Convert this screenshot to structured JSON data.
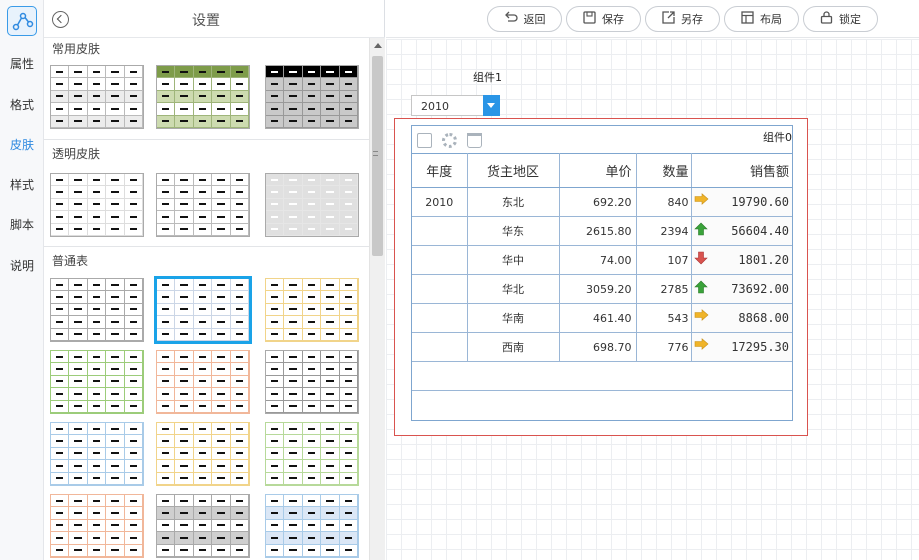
{
  "rail": {
    "tabs": [
      {
        "label": "属性",
        "active": false
      },
      {
        "label": "格式",
        "active": false
      },
      {
        "label": "皮肤",
        "active": true
      },
      {
        "label": "样式",
        "active": false
      },
      {
        "label": "脚本",
        "active": false
      },
      {
        "label": "说明",
        "active": false
      }
    ]
  },
  "panel": {
    "title": "设置",
    "sections": {
      "common": "常用皮肤",
      "transparent": "透明皮肤",
      "normal": "普通表"
    }
  },
  "toolbar": {
    "back": "返回",
    "save": "保存",
    "save_as": "另存",
    "layout": "布局",
    "lock": "锁定"
  },
  "canvas": {
    "widget1_label": "组件1",
    "select_value": "2010",
    "widget0_label": "组件0",
    "table": {
      "headers": [
        "年度",
        "货主地区",
        "单价",
        "数量",
        "销售额"
      ],
      "rows": [
        {
          "year": "2010",
          "region": "东北",
          "price": "692.20",
          "qty": "840",
          "trend": "right",
          "sales": "19790.60"
        },
        {
          "year": "",
          "region": "华东",
          "price": "2615.80",
          "qty": "2394",
          "trend": "up",
          "sales": "56604.40"
        },
        {
          "year": "",
          "region": "华中",
          "price": "74.00",
          "qty": "107",
          "trend": "down",
          "sales": "1801.20"
        },
        {
          "year": "",
          "region": "华北",
          "price": "3059.20",
          "qty": "2785",
          "trend": "up",
          "sales": "73692.00"
        },
        {
          "year": "",
          "region": "华南",
          "price": "461.40",
          "qty": "543",
          "trend": "right",
          "sales": "8868.00"
        },
        {
          "year": "",
          "region": "西南",
          "price": "698.70",
          "qty": "776",
          "trend": "right",
          "sales": "17295.30"
        }
      ]
    }
  },
  "colors": {
    "accent": "#2f8ae0",
    "sales_text": "#cc0000",
    "arrow_up": "#3aa33a",
    "arrow_down": "#d9534f",
    "arrow_right": "#f0b429"
  }
}
